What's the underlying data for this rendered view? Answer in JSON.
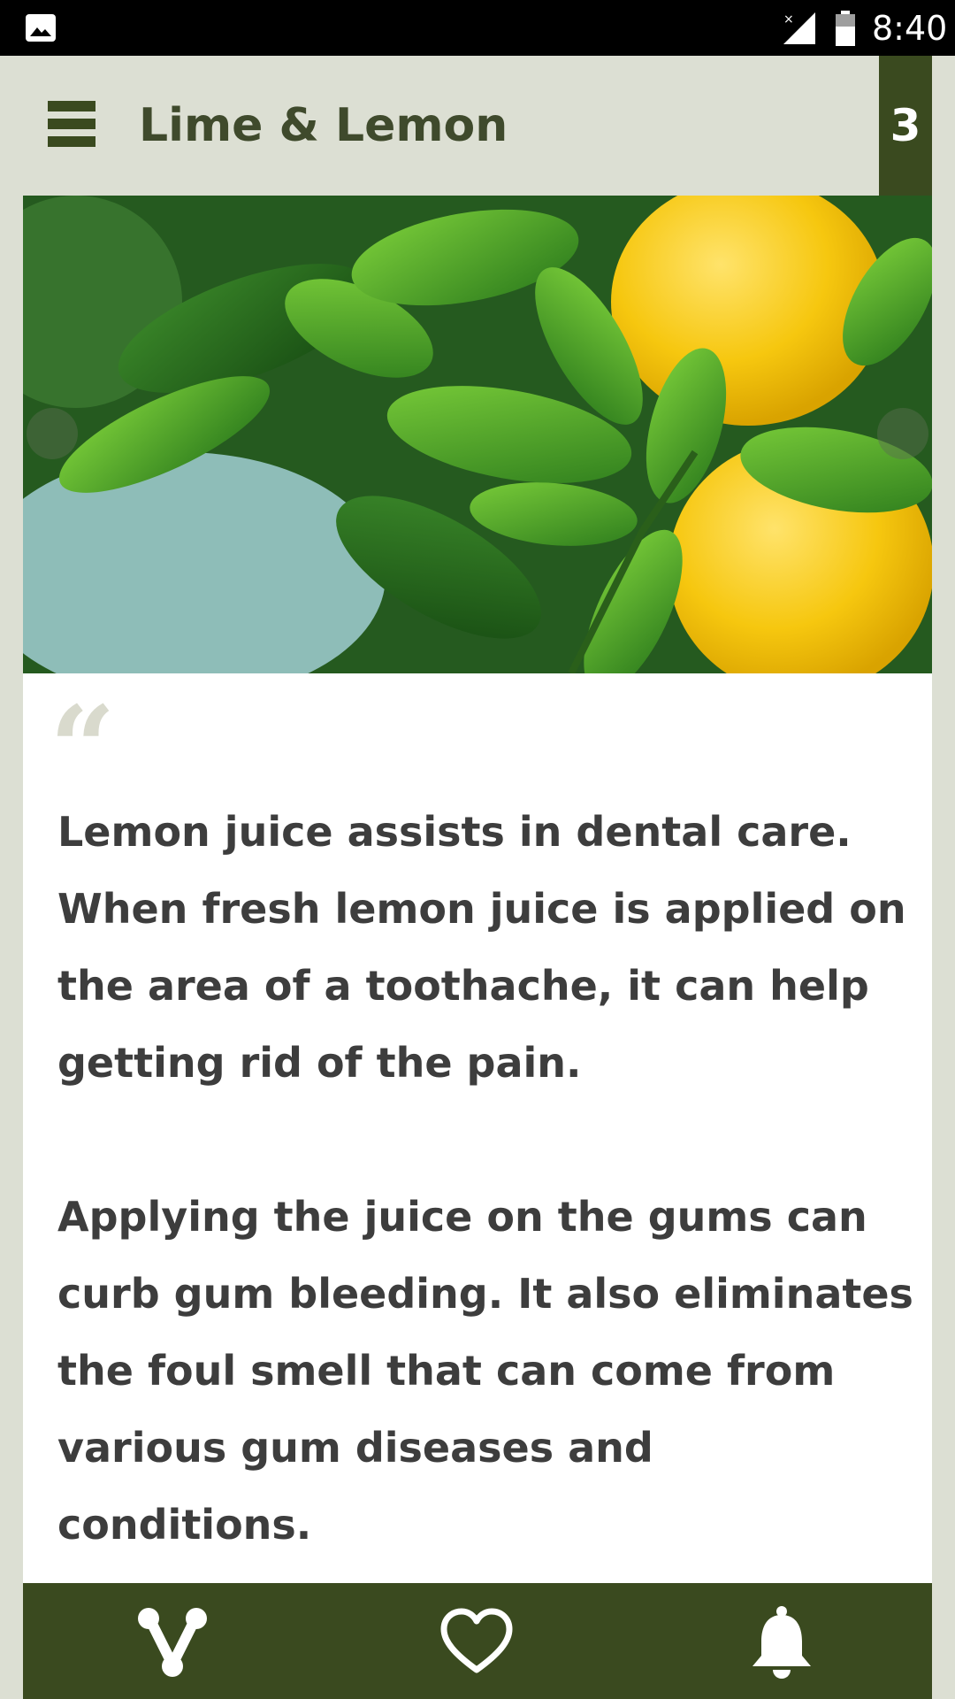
{
  "status_bar": {
    "time": "8:40",
    "icons": [
      "image-notification-icon",
      "signal-icon",
      "battery-icon"
    ]
  },
  "app_bar": {
    "title": "Lime & Lemon",
    "page_number": "3",
    "menu_icon": "hamburger-menu-icon"
  },
  "hero": {
    "description_icon": "lemon-tree-image",
    "prev_icon": "chevron-left-icon",
    "next_icon": "chevron-right-icon"
  },
  "content": {
    "quote_mark": "“",
    "paragraphs": [
      "Lemon juice assists in dental care. When fresh lemon juice is applied on the area of a toothache, it can help getting rid of the pain.",
      "Applying the juice on the gums can curb gum bleeding. It also eliminates the foul smell that can come from various gum diseases and conditions."
    ]
  },
  "bottom_nav": {
    "items": [
      "share-icon",
      "heart-icon",
      "bell-icon"
    ]
  },
  "colors": {
    "background": "#dcdfd3",
    "accent": "#3a4a1f",
    "title_text": "#3f4a2c",
    "body_text": "#3d3d3d"
  }
}
